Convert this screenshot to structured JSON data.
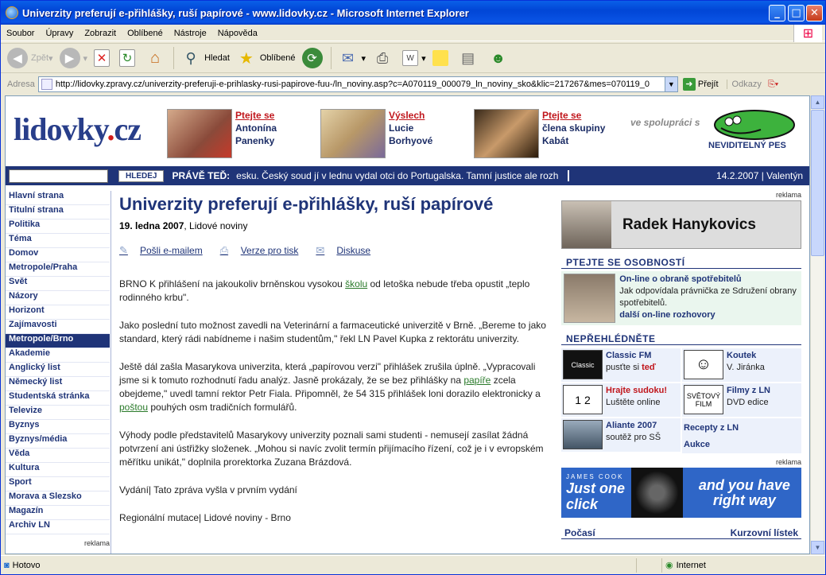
{
  "window": {
    "title": "Univerzity preferují e-přihlášky, ruší papírové - www.lidovky.cz - Microsoft Internet Explorer"
  },
  "menu": [
    "Soubor",
    "Úpravy",
    "Zobrazit",
    "Oblíbené",
    "Nástroje",
    "Nápověda"
  ],
  "toolbar": {
    "back": "Zpět",
    "search": "Hledat",
    "favorites": "Oblíbené"
  },
  "address": {
    "label": "Adresa",
    "url": "http://lidovky.zpravy.cz/univerzity-preferuji-e-prihlasky-rusi-papirove-fuu-/ln_noviny.asp?c=A070119_000079_ln_noviny_sko&klic=217267&mes=070119_0",
    "go": "Přejít",
    "links": "Odkazy"
  },
  "status": {
    "text": "Hotovo",
    "zone": "Internet"
  },
  "site": {
    "logo_main": "lidovky",
    "logo_dot": ".",
    "logo_tld": "cz",
    "partner": "ve spolupráci s",
    "partner_logo": "NEVIDITELNÝ PES"
  },
  "teasers": [
    {
      "l1": "Ptejte se",
      "l2": "Antonína",
      "l3": "Panenky"
    },
    {
      "l1": "Výslech",
      "l2": "Lucie",
      "l3": "Borhyové"
    },
    {
      "l1": "Ptejte se",
      "l2": "člena skupiny",
      "l3": "Kabát"
    }
  ],
  "topbar": {
    "search_button": "HLEDEJ",
    "prave_ted": "PRÁVĚ TEĎ:",
    "ticker": "esku. Český soud jí v lednu vydal otci do Portugalska. Tamní justice ale rozh",
    "date": "14.2.2007 | Valentýn"
  },
  "nav": [
    "Hlavní strana",
    "Titulní strana",
    "Politika",
    "Téma",
    "Domov",
    "Metropole/Praha",
    "Svět",
    "Názory",
    "Horizont",
    "Zajímavosti",
    "Metropole/Brno",
    "Akademie",
    "Anglický list",
    "Německý list",
    "Studentská stránka",
    "Televize",
    "Byznys",
    "Byznys/média",
    "Věda",
    "Kultura",
    "Sport",
    "Morava a Slezsko",
    "Magazín",
    "Archiv LN"
  ],
  "nav_active_index": 10,
  "nav_reklama": "reklama",
  "article": {
    "title": "Univerzity preferují e-přihlášky, ruší papírové",
    "date": "19. ledna 2007",
    "source": ", Lidové noviny",
    "tool_email": "Pošli e-mailem",
    "tool_print": "Verze pro tisk",
    "tool_discuss": "Diskuse",
    "p1a": "BRNO K přihlášení na jakoukoliv brněnskou vysokou ",
    "p1link": "školu",
    "p1b": " od letoška nebude třeba opustit „teplo rodinného krbu\".",
    "p2": "Jako poslední tuto možnost zavedli na Veterinární a farmaceutické univerzitě v Brně. „Bereme to jako standard, který rádi nabídneme i našim studentům,\" řekl LN Pavel Kupka z rektorátu univerzity.",
    "p3a": "Ještě dál zašla Masarykova univerzita, která „papírovou verzi\" přihlášek zrušila úplně. „Vypracovali jsme si k tomuto rozhodnutí řadu analýz. Jasně prokázaly, že se bez přihlášky na ",
    "p3link1": "papíře",
    "p3b": " zcela obejdeme,\" uvedl tamní rektor Petr Fiala. Připomněl, že 54 315 přihlášek loni dorazilo elektronicky a ",
    "p3link2": "poštou",
    "p3c": " pouhých osm tradičních formulářů.",
    "p4": "Výhody podle představitelů Masarykovy univerzity poznali sami studenti - nemusejí zasílat žádná potvrzení ani ústřižky složenek. „Mohou si navíc zvolit termín přijímacího řízení, což je i v evropském měřítku unikát,\" doplnila prorektorka Zuzana Brázdová.",
    "p5": "Vydání| Tato zpráva vyšla v prvním vydání",
    "p6": "Regionální mutace| Lidové noviny - Brno"
  },
  "right": {
    "reklama1": "reklama",
    "banner1": "Radek Hanykovics",
    "ptejte_hdr": "PTEJTE SE OSOBNOSTÍ",
    "interview_title": "On-line o obraně spotřebitelů",
    "interview_text": "Jak odpovídala právnička ze Sdružení obrany spotřebitelů.",
    "interview_more": "další on-line rozhovory",
    "miss_hdr": "NEPŘEHLÉDNĚTE",
    "miss": [
      {
        "thumb": "Classic",
        "title": "Classic FM",
        "text": "pusťte si ",
        "text_red": "teď"
      },
      {
        "thumb": "☺",
        "title": "Koutek",
        "text": "V. Jiránka"
      },
      {
        "thumb": "1 2",
        "title": "Hrajte sudoku!",
        "text": "Luštěte online"
      },
      {
        "thumb": "SVĚTOVÝ FILM",
        "title": "Filmy z LN",
        "text": "DVD edice"
      },
      {
        "thumb": "",
        "title": "Aliante 2007",
        "text": "soutěž pro SŠ"
      }
    ],
    "recepty": "Recepty z LN",
    "aukce": "Aukce",
    "reklama2": "reklama",
    "banner2_small": "JAMES COOK",
    "banner2_left": "Just one click",
    "banner2_right": "and you have right way",
    "pocasi": "Počasí",
    "kurzy": "Kurzovní lístek"
  },
  "colors": {
    "brand": "#1f3478",
    "accent": "#c0161c",
    "link_green": "#2a7a2a"
  }
}
